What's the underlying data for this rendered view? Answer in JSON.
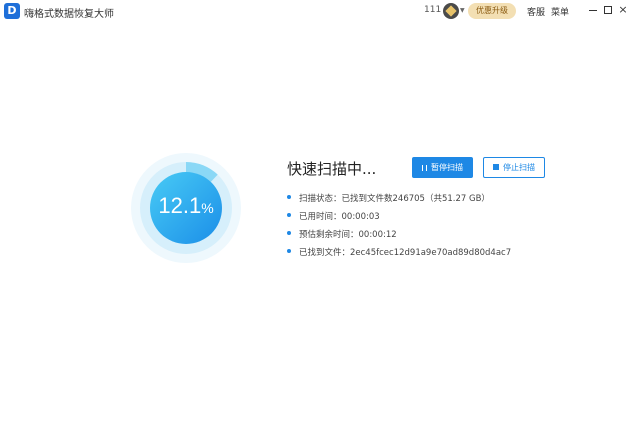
{
  "titlebar": {
    "app_title": "嗨格式数据恢复大师",
    "logo_letter": "D",
    "user_id": "111",
    "upgrade_label": "优惠升级",
    "service_label": "客服",
    "menu_label": "菜单",
    "close_glyph": "×"
  },
  "progress": {
    "percent": 12.1,
    "percent_number": "12.1",
    "percent_sign": "%"
  },
  "scan": {
    "title": "快速扫描中...",
    "pause_label": "暂停扫描",
    "stop_label": "停止扫描",
    "info": [
      "扫描状态：已找到文件数246705（共51.27 GB）",
      "已用时间：00:00:03",
      "预估剩余时间：00:00:12",
      "已找到文件：2ec45fcec12d91a9e70ad89d80d4ac71.w"
    ]
  },
  "colors": {
    "accent": "#1e88e5",
    "ring_light": "#e6f4fc",
    "ring_gradient_start": "#3fc4f4",
    "ring_gradient_end": "#1b8ee8",
    "upgrade_bg": "#f3dfb3"
  },
  "icons": {
    "logo": "app-logo-icon",
    "vip": "vip-badge-icon",
    "pause": "pause-icon",
    "stop": "stop-icon"
  }
}
